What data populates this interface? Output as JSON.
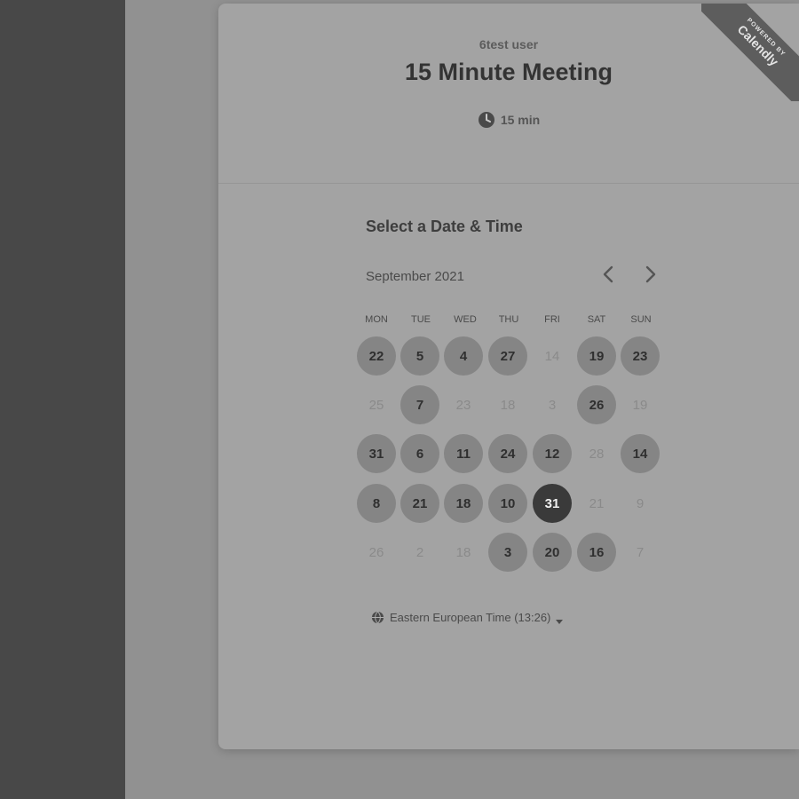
{
  "ribbon": {
    "small_text": "POWERED BY",
    "brand": "Calendly"
  },
  "header": {
    "user_name": "6test user",
    "event_title": "15 Minute Meeting",
    "duration": "15 min",
    "duration_icon": "clock-icon"
  },
  "calendar": {
    "section_title": "Select a Date & Time",
    "month_label": "September 2021",
    "prev_icon": "chevron-left-icon",
    "next_icon": "chevron-right-icon",
    "weekdays": [
      "MON",
      "TUE",
      "WED",
      "THU",
      "FRI",
      "SAT",
      "SUN"
    ],
    "weeks": [
      [
        {
          "label": "22",
          "state": "available"
        },
        {
          "label": "5",
          "state": "available"
        },
        {
          "label": "4",
          "state": "available"
        },
        {
          "label": "27",
          "state": "available"
        },
        {
          "label": "14",
          "state": "unavailable"
        },
        {
          "label": "19",
          "state": "available"
        },
        {
          "label": "23",
          "state": "available"
        }
      ],
      [
        {
          "label": "25",
          "state": "unavailable"
        },
        {
          "label": "7",
          "state": "available"
        },
        {
          "label": "23",
          "state": "unavailable"
        },
        {
          "label": "18",
          "state": "unavailable"
        },
        {
          "label": "3",
          "state": "unavailable"
        },
        {
          "label": "26",
          "state": "available"
        },
        {
          "label": "19",
          "state": "unavailable"
        }
      ],
      [
        {
          "label": "31",
          "state": "available"
        },
        {
          "label": "6",
          "state": "available"
        },
        {
          "label": "11",
          "state": "available"
        },
        {
          "label": "24",
          "state": "available"
        },
        {
          "label": "12",
          "state": "available"
        },
        {
          "label": "28",
          "state": "unavailable"
        },
        {
          "label": "14",
          "state": "available"
        }
      ],
      [
        {
          "label": "8",
          "state": "available"
        },
        {
          "label": "21",
          "state": "available"
        },
        {
          "label": "18",
          "state": "available"
        },
        {
          "label": "10",
          "state": "available"
        },
        {
          "label": "31",
          "state": "selected"
        },
        {
          "label": "21",
          "state": "unavailable"
        },
        {
          "label": "9",
          "state": "unavailable"
        }
      ],
      [
        {
          "label": "26",
          "state": "unavailable"
        },
        {
          "label": "2",
          "state": "unavailable"
        },
        {
          "label": "18",
          "state": "unavailable"
        },
        {
          "label": "3",
          "state": "available"
        },
        {
          "label": "20",
          "state": "available"
        },
        {
          "label": "16",
          "state": "available"
        },
        {
          "label": "7",
          "state": "unavailable"
        }
      ]
    ]
  },
  "timezone": {
    "label": "Eastern European Time (13:26)",
    "icon": "globe-icon",
    "caret_icon": "caret-down-icon"
  },
  "colors": {
    "available_bg": "#858585",
    "selected_bg": "#3a3a3a"
  }
}
